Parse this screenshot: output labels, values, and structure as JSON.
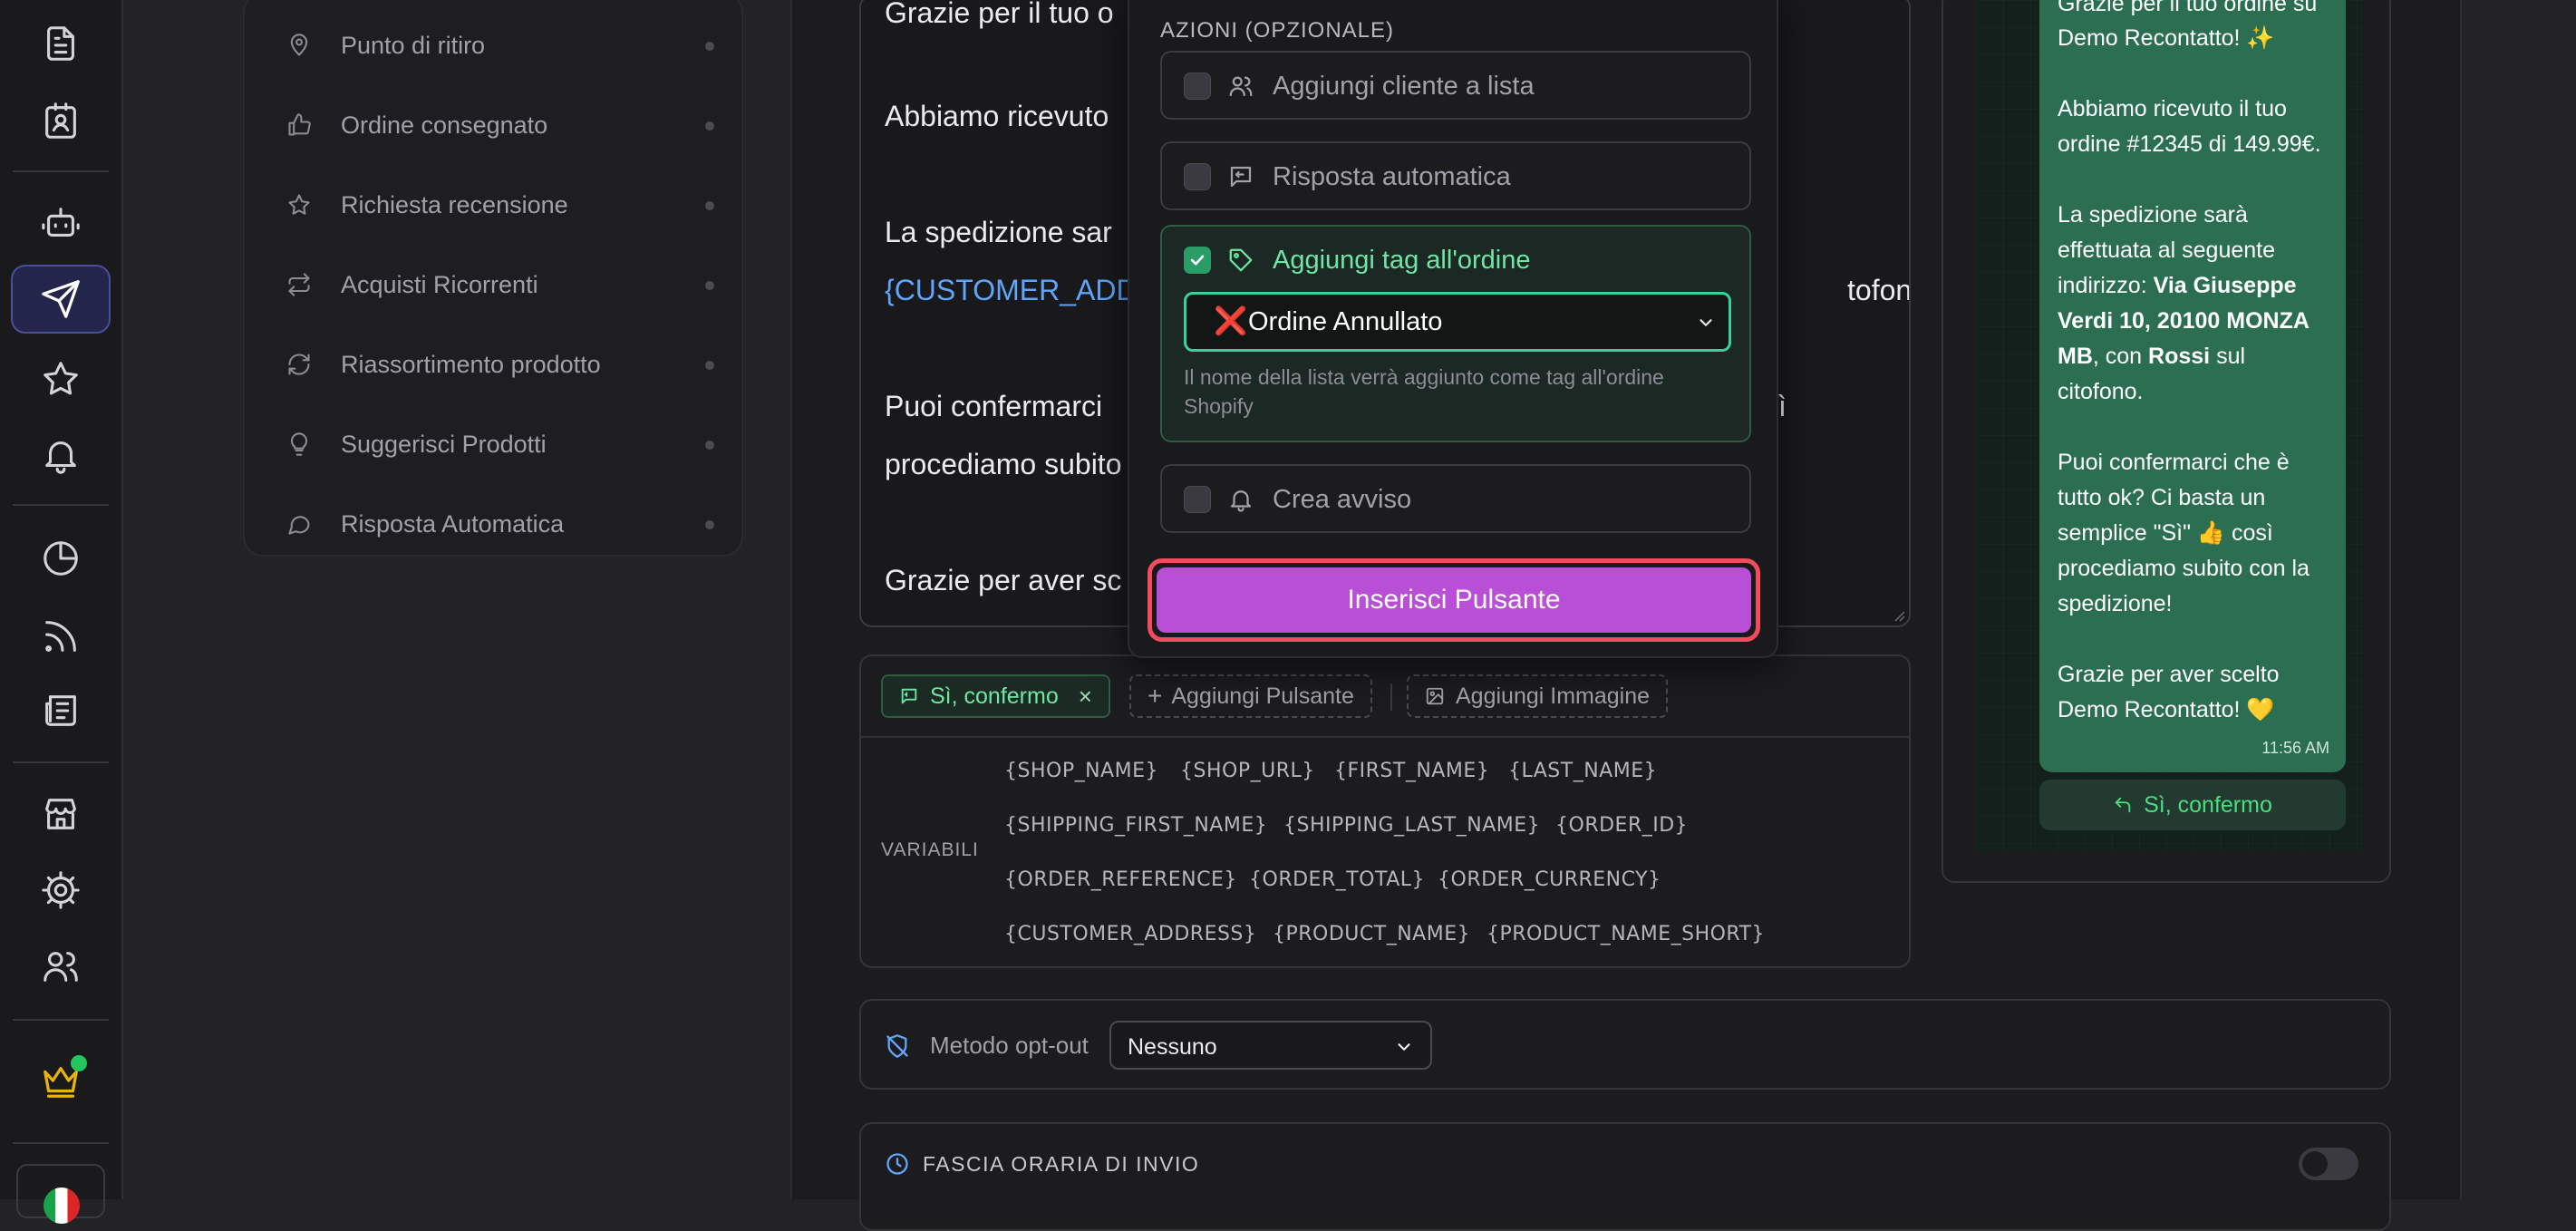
{
  "rail": {
    "icons": [
      "document-icon",
      "contact-card-icon",
      "robot-icon",
      "send-icon",
      "star-icon",
      "bell-icon",
      "pie-chart-icon",
      "rss-icon",
      "newspaper-icon",
      "store-icon",
      "gear-icon",
      "users-icon",
      "crown-icon"
    ]
  },
  "sidebar": {
    "items": [
      {
        "label": "Punto di ritiro",
        "icon": "map-pin-icon"
      },
      {
        "label": "Ordine consegnato",
        "icon": "thumbs-up-icon"
      },
      {
        "label": "Richiesta recensione",
        "icon": "star-icon"
      },
      {
        "label": "Acquisti Ricorrenti",
        "icon": "repeat-icon"
      },
      {
        "label": "Riassortimento prodotto",
        "icon": "refresh-icon"
      },
      {
        "label": "Suggerisci Prodotti",
        "icon": "lightbulb-icon"
      },
      {
        "label": "Risposta Automatica",
        "icon": "chat-bubble-icon"
      }
    ]
  },
  "editor": {
    "lines": [
      "Grazie per il tuo o",
      "Abbiamo ricevuto",
      "La spedizione sar",
      "{CUSTOMER_ADD",
      "tofono.",
      "Puoi confermarci",
      "ì",
      "procediamo subito",
      "Grazie per aver sc"
    ]
  },
  "popover": {
    "title": "AZIONI (OPZIONALE)",
    "actions": [
      {
        "label": "Aggiungi cliente a lista",
        "checked": false,
        "icon": "users-icon"
      },
      {
        "label": "Risposta automatica",
        "checked": false,
        "icon": "message-reply-icon"
      },
      {
        "label": "Aggiungi tag all'ordine",
        "checked": true,
        "icon": "tag-icon"
      },
      {
        "label": "Crea avviso",
        "checked": false,
        "icon": "bell-icon"
      }
    ],
    "tag_select": {
      "emoji": "❌",
      "value": "Ordine Annullato"
    },
    "tag_help": "Il nome della lista verrà aggiunto come tag all'ordine Shopify",
    "insert_button": "Inserisci Pulsante"
  },
  "buttons_panel": {
    "confirm_chip": "Sì, confermo",
    "add_button": "Aggiungi Pulsante",
    "add_image": "Aggiungi Immagine",
    "variables_label": "VARIABILI",
    "variables": [
      [
        "{SHOP_NAME}",
        "{SHOP_URL}",
        "{FIRST_NAME}",
        "{LAST_NAME}"
      ],
      [
        "{SHIPPING_FIRST_NAME}",
        "{SHIPPING_LAST_NAME}",
        "{ORDER_ID}"
      ],
      [
        "{ORDER_REFERENCE}",
        "{ORDER_TOTAL}",
        "{ORDER_CURRENCY}"
      ],
      [
        "{CUSTOMER_ADDRESS}",
        "{PRODUCT_NAME}",
        "{PRODUCT_NAME_SHORT}"
      ]
    ]
  },
  "optout": {
    "label": "Metodo opt-out",
    "value": "Nessuno"
  },
  "fascia": {
    "label": "FASCIA ORARIA DI INVIO",
    "enabled": false
  },
  "preview": {
    "lines": [
      "Grazie per il tuo ordine su",
      "Demo Recontatto! ✨",
      "",
      "Abbiamo ricevuto il tuo",
      "ordine #12345 di 149.99€.",
      "",
      "La spedizione sarà",
      "effettuata al seguente",
      "indirizzo: ",
      "Via Giuseppe",
      "Verdi 10, 20100 MONZA",
      "MB",
      ", con ",
      "Rossi",
      " sul",
      "citofono.",
      "Puoi confermarci che è",
      "tutto ok? Ci basta un",
      "semplice \"Sì\" 👍 così",
      "procediamo subito con la",
      "spedizione!",
      "Grazie per aver scelto",
      "Demo Recontatto! 💛"
    ],
    "time": "11:56 AM",
    "button": "Sì, confermo"
  }
}
